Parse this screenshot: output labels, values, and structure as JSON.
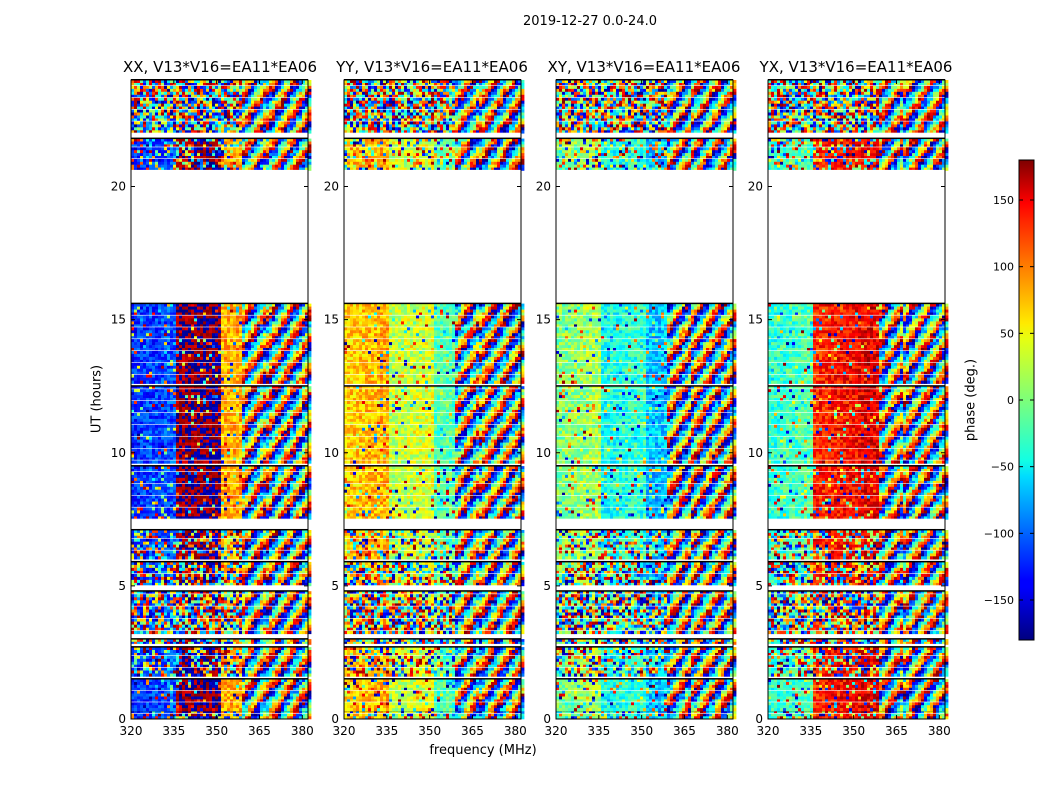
{
  "chart_data": {
    "type": "heatmap",
    "suptitle": "2019-12-27 0.0-24.0",
    "xlabel": "frequency (MHz)",
    "ylabel": "UT (hours)",
    "colorbar_label": "phase (deg.)",
    "xlim": [
      320,
      382
    ],
    "ylim": [
      0,
      24
    ],
    "xticks": [
      320,
      335,
      350,
      365,
      380
    ],
    "yticks": [
      0,
      5,
      10,
      15,
      20
    ],
    "clim": [
      -180,
      180
    ],
    "colorbar_ticks": [
      150,
      100,
      50,
      0,
      -50,
      -100,
      -150
    ],
    "colormap": "jet",
    "panels": [
      {
        "title": "XX, V13*V16=EA11*EA06",
        "profile": [
          -120,
          170,
          70,
          20
        ]
      },
      {
        "title": "YY, V13*V16=EA11*EA06",
        "profile": [
          60,
          20,
          -20,
          -90
        ]
      },
      {
        "title": "XY, V13*V16=EA11*EA06",
        "profile": [
          0,
          -40,
          -70,
          10
        ]
      },
      {
        "title": "YX, V13*V16=EA11*EA06",
        "profile": [
          -30,
          120,
          140,
          10
        ]
      }
    ],
    "time_blocks": [
      {
        "from": 0.0,
        "to": 0.3,
        "coherent": 0.6
      },
      {
        "from": 0.3,
        "to": 1.5,
        "coherent": 0.8
      },
      {
        "from": 1.6,
        "to": 2.7,
        "coherent": 0.5
      },
      {
        "from": 2.8,
        "to": 3.0,
        "coherent": 0.2
      },
      {
        "from": 3.2,
        "to": 4.8,
        "coherent": 0.1
      },
      {
        "from": 5.0,
        "to": 5.9,
        "coherent": 0.3
      },
      {
        "from": 6.0,
        "to": 7.1,
        "coherent": 0.5
      },
      {
        "from": 7.5,
        "to": 9.5,
        "coherent": 0.85
      },
      {
        "from": 9.6,
        "to": 12.5,
        "coherent": 0.9
      },
      {
        "from": 12.6,
        "to": 15.6,
        "coherent": 0.9
      },
      {
        "from": 20.6,
        "to": 21.8,
        "coherent": 0.6
      },
      {
        "from": 22.0,
        "to": 24.0,
        "coherent": 0.05
      }
    ]
  }
}
